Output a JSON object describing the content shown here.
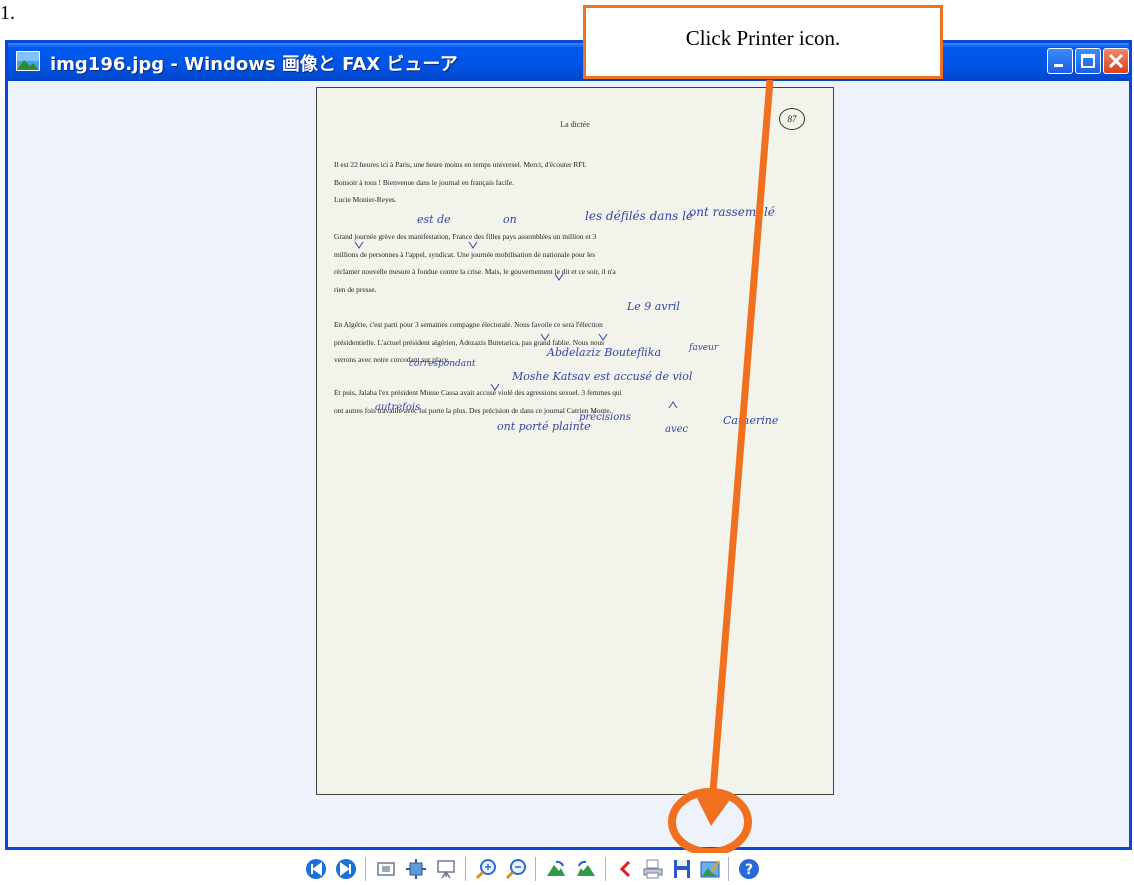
{
  "step_number": "1.",
  "window": {
    "title": "img196.jpg - Windows 画像と FAX ビューア",
    "buttons": [
      "minimize",
      "maximize",
      "close"
    ]
  },
  "document": {
    "title": "La dictée",
    "page_number": "87",
    "paragraphs": [
      [
        "Il est 22 heures ici à Paris, une heure moins en temps universel. Merci, d'écouter RFI.",
        "Bonsoir à tous ! Bienvenue dans le journal en français facile.",
        "Lucie Monier-Reyes."
      ],
      [
        "Grand journée grève des manifestation, France des filles pays assemblées un million et 3",
        "millions de personnes à l'appel, syndicat. Une journée mobilisation de nationale pour les",
        "réclamer nouvelle mesure à fondue contre la crise. Mais, le gouvernement le dit et ce soir, il n'a",
        "rien de presse."
      ],
      [
        "En Algérie, c'est parti pour 3 semaines compagne électorale. Nous favoile ce sera l'élection",
        "présidentielle. L'actuel président algérien, Adezazis Butetarica, pas grand fablie. Nous nous",
        "verrons avec notre corcodant sur place."
      ],
      [
        "Et puis, Jalaba l'ex président Musse Cassa avait accusé violé des agressions sexuel. 3 femmes qui",
        "ont autres fois travaillé avec lui porte la plus. Des précision de dans ce journal Catrien Monte."
      ]
    ],
    "annotations": [
      "est de",
      "on",
      "les défilés dans le",
      "ont rassemblé",
      "Le 9 avril",
      "Abdelaziz Bouteflika",
      "Moshe Katsav est accusé de viol",
      "ont porté plainte",
      "précisions",
      "avec",
      "Catherine",
      "autrefois",
      "correspondant",
      "faveur"
    ]
  },
  "toolbar": {
    "icons": [
      "previous-image-icon",
      "next-image-icon",
      "best-fit-icon",
      "actual-size-icon",
      "slideshow-icon",
      "zoom-in-icon",
      "zoom-out-icon",
      "rotate-clockwise-icon",
      "rotate-counterclockwise-icon",
      "delete-icon",
      "print-icon",
      "save-icon",
      "open-editor-icon",
      "help-icon"
    ]
  },
  "callout": {
    "text": "Click Printer icon."
  },
  "colors": {
    "titlebar": "#0054e3",
    "accent_orange": "#f07020",
    "ink": "#3344aa",
    "viewer_bg": "#eef2fb"
  }
}
